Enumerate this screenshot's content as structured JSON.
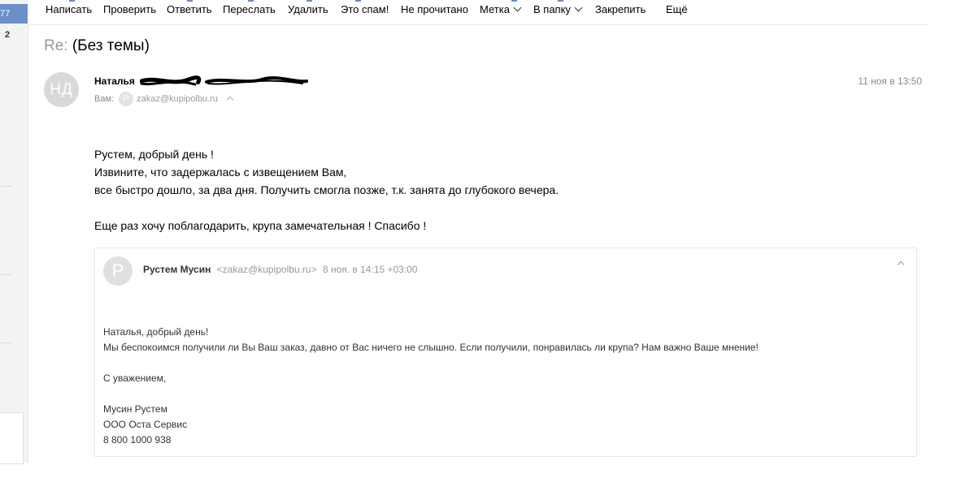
{
  "left_strip": {
    "counter_active": "77",
    "counter_unread": "2"
  },
  "toolbar": {
    "compose": "Написать",
    "check": "Проверить",
    "reply": "Ответить",
    "forward": "Переслать",
    "delete": "Удалить",
    "spam": "Это спам!",
    "unread": "Не прочитано",
    "label": "Метка",
    "to_folder": "В папку",
    "pin": "Закрепить",
    "more": "Ещё"
  },
  "message": {
    "subject_prefix": "Re:",
    "subject": "(Без темы)",
    "avatar_initials": "НД",
    "sender_name": "Наталья",
    "to_label": "Вам:",
    "to_avatar_letter": "P",
    "to_address": "zakaz@kupipolbu.ru",
    "date": "11 ноя в 13:50",
    "body": {
      "line1": "Рустем, добрый день !",
      "line2": "Извините, что задержалась с извещением Вам,",
      "line3": "все быстро дошло, за два дня. Получить смогла позже, т.к. занята до глубокого вечера.",
      "line4": "Еще раз хочу поблагодарить, крупа замечательная ! Спасибо !"
    }
  },
  "quote": {
    "avatar_letter": "P",
    "sender_name": "Рустем Мусин",
    "sender_email": "<zakaz@kupipolbu.ru>",
    "date": "8 ноя. в 14:15 +03:00",
    "body": {
      "greeting": "Наталья, добрый день!",
      "text": "Мы беспокоимся получили ли Вы Ваш заказ, давно от Вас ничего не слышно. Если получили, понравилась ли крупа? Нам важно Ваше мнение!",
      "regards": "С уважением,",
      "sig_name": "Мусин Рустем",
      "sig_company": "ООО Оста Сервис",
      "sig_phone": "8 800 1000 938"
    }
  },
  "colors": {
    "accent": "#6b8fc9",
    "muted_text": "#888888",
    "border": "#e6e6e6"
  }
}
